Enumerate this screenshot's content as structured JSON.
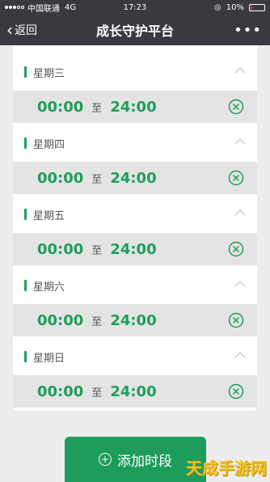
{
  "status": {
    "carrier": "中国联通",
    "network": "4G",
    "time": "17:23",
    "battery": "10%"
  },
  "nav": {
    "back_label": "返回",
    "title": "成长守护平台",
    "more": "•••"
  },
  "days": [
    {
      "label": "星期三",
      "start": "00:00",
      "sep": "至",
      "end": "24:00"
    },
    {
      "label": "星期四",
      "start": "00:00",
      "sep": "至",
      "end": "24:00"
    },
    {
      "label": "星期五",
      "start": "00:00",
      "sep": "至",
      "end": "24:00"
    },
    {
      "label": "星期六",
      "start": "00:00",
      "sep": "至",
      "end": "24:00"
    },
    {
      "label": "星期日",
      "start": "00:00",
      "sep": "至",
      "end": "24:00"
    }
  ],
  "add_button": {
    "label": "添加时段"
  },
  "watermark": "天成手游网",
  "colors": {
    "accent": "#1d9e5b",
    "navbar": "#393a3f"
  }
}
